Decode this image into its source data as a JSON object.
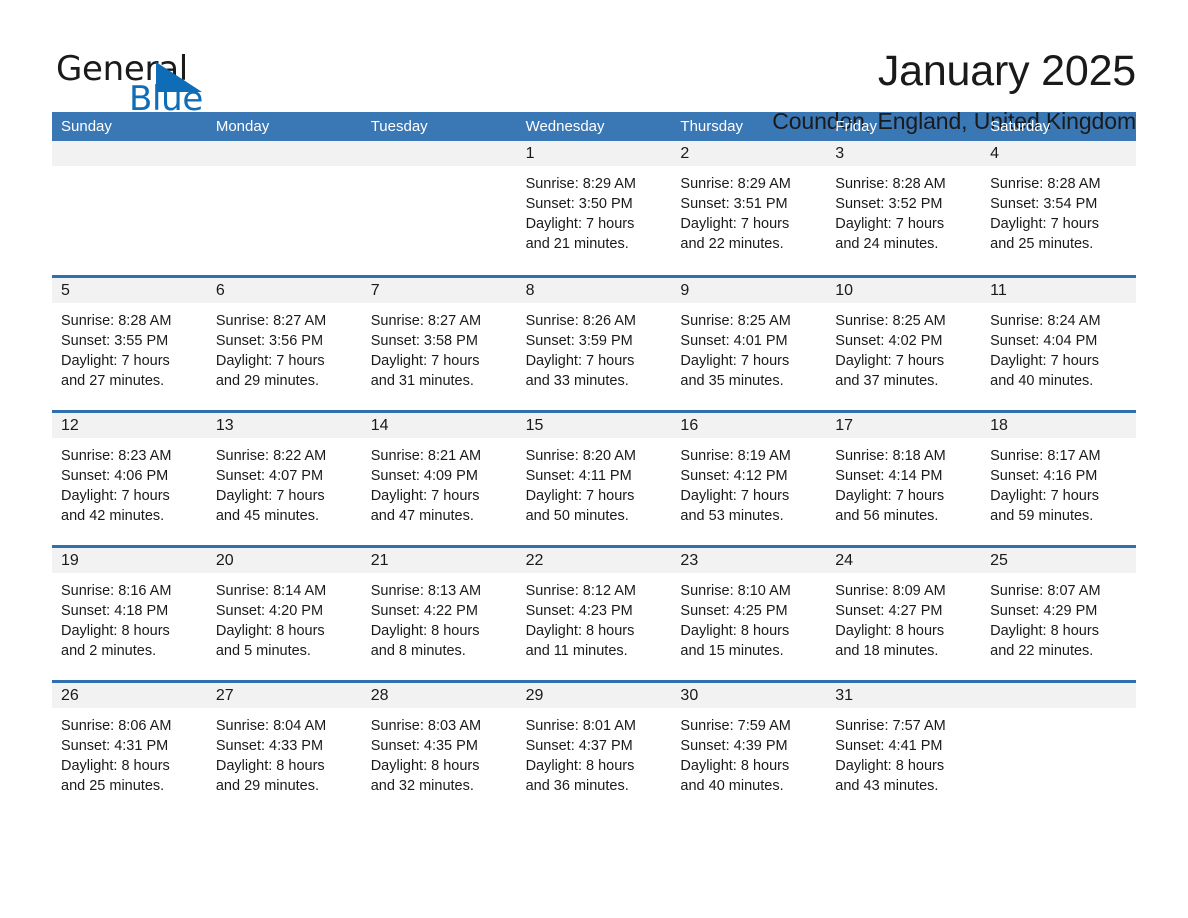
{
  "brand": {
    "name_part1": "General",
    "name_part2": "Blue",
    "accent_color": "#0f6cb6",
    "logo_icon": "triangle-flag-icon"
  },
  "header": {
    "month_title": "January 2025",
    "location": "Coundon, England, United Kingdom"
  },
  "calendar": {
    "header_bg": "#3a77b5",
    "row_divider_color": "#2f6fae",
    "daynum_band_bg": "#f2f2f2",
    "weekdays": [
      "Sunday",
      "Monday",
      "Tuesday",
      "Wednesday",
      "Thursday",
      "Friday",
      "Saturday"
    ],
    "weeks": [
      [
        {
          "day": "",
          "empty": true
        },
        {
          "day": "",
          "empty": true
        },
        {
          "day": "",
          "empty": true
        },
        {
          "day": "1",
          "sunrise": "Sunrise: 8:29 AM",
          "sunset": "Sunset: 3:50 PM",
          "daylight_1": "Daylight: 7 hours",
          "daylight_2": "and 21 minutes."
        },
        {
          "day": "2",
          "sunrise": "Sunrise: 8:29 AM",
          "sunset": "Sunset: 3:51 PM",
          "daylight_1": "Daylight: 7 hours",
          "daylight_2": "and 22 minutes."
        },
        {
          "day": "3",
          "sunrise": "Sunrise: 8:28 AM",
          "sunset": "Sunset: 3:52 PM",
          "daylight_1": "Daylight: 7 hours",
          "daylight_2": "and 24 minutes."
        },
        {
          "day": "4",
          "sunrise": "Sunrise: 8:28 AM",
          "sunset": "Sunset: 3:54 PM",
          "daylight_1": "Daylight: 7 hours",
          "daylight_2": "and 25 minutes."
        }
      ],
      [
        {
          "day": "5",
          "sunrise": "Sunrise: 8:28 AM",
          "sunset": "Sunset: 3:55 PM",
          "daylight_1": "Daylight: 7 hours",
          "daylight_2": "and 27 minutes."
        },
        {
          "day": "6",
          "sunrise": "Sunrise: 8:27 AM",
          "sunset": "Sunset: 3:56 PM",
          "daylight_1": "Daylight: 7 hours",
          "daylight_2": "and 29 minutes."
        },
        {
          "day": "7",
          "sunrise": "Sunrise: 8:27 AM",
          "sunset": "Sunset: 3:58 PM",
          "daylight_1": "Daylight: 7 hours",
          "daylight_2": "and 31 minutes."
        },
        {
          "day": "8",
          "sunrise": "Sunrise: 8:26 AM",
          "sunset": "Sunset: 3:59 PM",
          "daylight_1": "Daylight: 7 hours",
          "daylight_2": "and 33 minutes."
        },
        {
          "day": "9",
          "sunrise": "Sunrise: 8:25 AM",
          "sunset": "Sunset: 4:01 PM",
          "daylight_1": "Daylight: 7 hours",
          "daylight_2": "and 35 minutes."
        },
        {
          "day": "10",
          "sunrise": "Sunrise: 8:25 AM",
          "sunset": "Sunset: 4:02 PM",
          "daylight_1": "Daylight: 7 hours",
          "daylight_2": "and 37 minutes."
        },
        {
          "day": "11",
          "sunrise": "Sunrise: 8:24 AM",
          "sunset": "Sunset: 4:04 PM",
          "daylight_1": "Daylight: 7 hours",
          "daylight_2": "and 40 minutes."
        }
      ],
      [
        {
          "day": "12",
          "sunrise": "Sunrise: 8:23 AM",
          "sunset": "Sunset: 4:06 PM",
          "daylight_1": "Daylight: 7 hours",
          "daylight_2": "and 42 minutes."
        },
        {
          "day": "13",
          "sunrise": "Sunrise: 8:22 AM",
          "sunset": "Sunset: 4:07 PM",
          "daylight_1": "Daylight: 7 hours",
          "daylight_2": "and 45 minutes."
        },
        {
          "day": "14",
          "sunrise": "Sunrise: 8:21 AM",
          "sunset": "Sunset: 4:09 PM",
          "daylight_1": "Daylight: 7 hours",
          "daylight_2": "and 47 minutes."
        },
        {
          "day": "15",
          "sunrise": "Sunrise: 8:20 AM",
          "sunset": "Sunset: 4:11 PM",
          "daylight_1": "Daylight: 7 hours",
          "daylight_2": "and 50 minutes."
        },
        {
          "day": "16",
          "sunrise": "Sunrise: 8:19 AM",
          "sunset": "Sunset: 4:12 PM",
          "daylight_1": "Daylight: 7 hours",
          "daylight_2": "and 53 minutes."
        },
        {
          "day": "17",
          "sunrise": "Sunrise: 8:18 AM",
          "sunset": "Sunset: 4:14 PM",
          "daylight_1": "Daylight: 7 hours",
          "daylight_2": "and 56 minutes."
        },
        {
          "day": "18",
          "sunrise": "Sunrise: 8:17 AM",
          "sunset": "Sunset: 4:16 PM",
          "daylight_1": "Daylight: 7 hours",
          "daylight_2": "and 59 minutes."
        }
      ],
      [
        {
          "day": "19",
          "sunrise": "Sunrise: 8:16 AM",
          "sunset": "Sunset: 4:18 PM",
          "daylight_1": "Daylight: 8 hours",
          "daylight_2": "and 2 minutes."
        },
        {
          "day": "20",
          "sunrise": "Sunrise: 8:14 AM",
          "sunset": "Sunset: 4:20 PM",
          "daylight_1": "Daylight: 8 hours",
          "daylight_2": "and 5 minutes."
        },
        {
          "day": "21",
          "sunrise": "Sunrise: 8:13 AM",
          "sunset": "Sunset: 4:22 PM",
          "daylight_1": "Daylight: 8 hours",
          "daylight_2": "and 8 minutes."
        },
        {
          "day": "22",
          "sunrise": "Sunrise: 8:12 AM",
          "sunset": "Sunset: 4:23 PM",
          "daylight_1": "Daylight: 8 hours",
          "daylight_2": "and 11 minutes."
        },
        {
          "day": "23",
          "sunrise": "Sunrise: 8:10 AM",
          "sunset": "Sunset: 4:25 PM",
          "daylight_1": "Daylight: 8 hours",
          "daylight_2": "and 15 minutes."
        },
        {
          "day": "24",
          "sunrise": "Sunrise: 8:09 AM",
          "sunset": "Sunset: 4:27 PM",
          "daylight_1": "Daylight: 8 hours",
          "daylight_2": "and 18 minutes."
        },
        {
          "day": "25",
          "sunrise": "Sunrise: 8:07 AM",
          "sunset": "Sunset: 4:29 PM",
          "daylight_1": "Daylight: 8 hours",
          "daylight_2": "and 22 minutes."
        }
      ],
      [
        {
          "day": "26",
          "sunrise": "Sunrise: 8:06 AM",
          "sunset": "Sunset: 4:31 PM",
          "daylight_1": "Daylight: 8 hours",
          "daylight_2": "and 25 minutes."
        },
        {
          "day": "27",
          "sunrise": "Sunrise: 8:04 AM",
          "sunset": "Sunset: 4:33 PM",
          "daylight_1": "Daylight: 8 hours",
          "daylight_2": "and 29 minutes."
        },
        {
          "day": "28",
          "sunrise": "Sunrise: 8:03 AM",
          "sunset": "Sunset: 4:35 PM",
          "daylight_1": "Daylight: 8 hours",
          "daylight_2": "and 32 minutes."
        },
        {
          "day": "29",
          "sunrise": "Sunrise: 8:01 AM",
          "sunset": "Sunset: 4:37 PM",
          "daylight_1": "Daylight: 8 hours",
          "daylight_2": "and 36 minutes."
        },
        {
          "day": "30",
          "sunrise": "Sunrise: 7:59 AM",
          "sunset": "Sunset: 4:39 PM",
          "daylight_1": "Daylight: 8 hours",
          "daylight_2": "and 40 minutes."
        },
        {
          "day": "31",
          "sunrise": "Sunrise: 7:57 AM",
          "sunset": "Sunset: 4:41 PM",
          "daylight_1": "Daylight: 8 hours",
          "daylight_2": "and 43 minutes."
        },
        {
          "day": "",
          "empty": true
        }
      ]
    ]
  }
}
